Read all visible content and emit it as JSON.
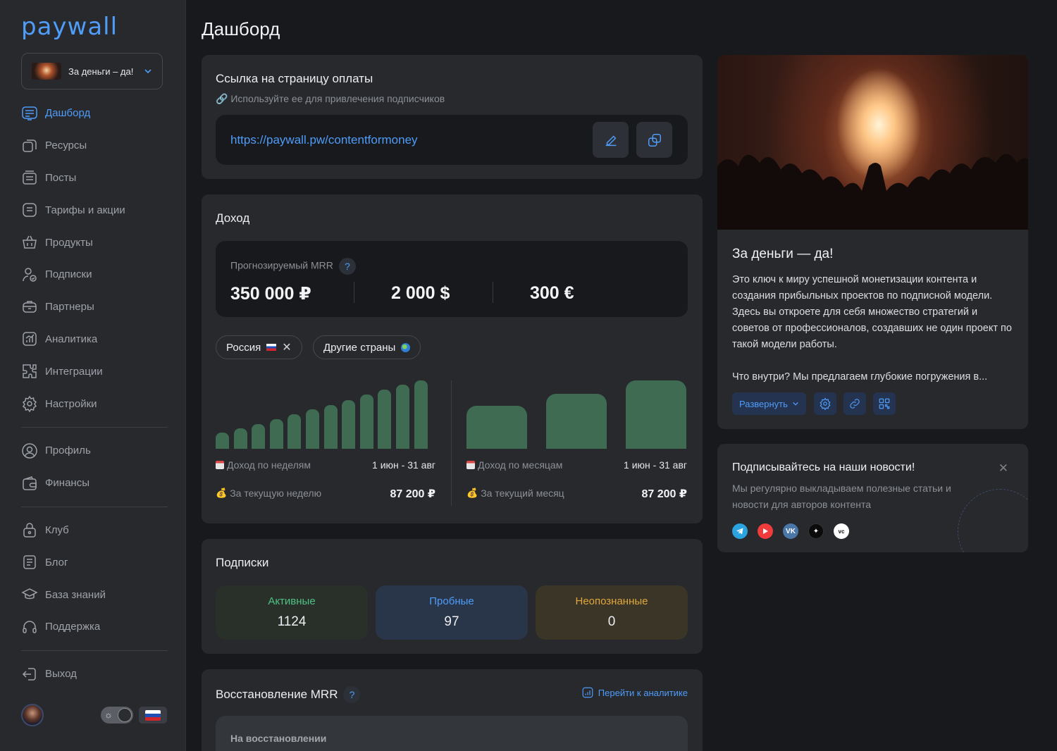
{
  "app": {
    "logo": "paywall"
  },
  "project_select": {
    "name": "За деньги – да!"
  },
  "nav": {
    "main": [
      "Дашборд",
      "Ресурсы",
      "Посты",
      "Тарифы и акции",
      "Продукты",
      "Подписки",
      "Партнеры",
      "Аналитика",
      "Интеграции",
      "Настройки"
    ],
    "account": [
      "Профиль",
      "Финансы"
    ],
    "resources": [
      "Клуб",
      "Блог",
      "База знаний",
      "Поддержка"
    ],
    "logout": "Выход"
  },
  "page": {
    "title": "Дашборд"
  },
  "payment_link": {
    "title": "Ссылка на страницу оплаты",
    "hint": "Используйте ее для привлечения подписчиков",
    "url": "https://paywall.pw/contentformoney"
  },
  "income": {
    "title": "Доход",
    "mrr_label": "Прогнозируемый MRR",
    "mrr_values": [
      "350 000 ₽",
      "2 000 $",
      "300 €"
    ],
    "chips": [
      "Россия",
      "Другие страны"
    ],
    "weekly": {
      "caption": "Доход по неделям",
      "period": "1 июн - 31 авг",
      "current_label": "За текущую неделю",
      "current_value": "87 200 ₽"
    },
    "monthly": {
      "caption": "Доход по месяцам",
      "period": "1 июн - 31 авг",
      "current_label": "За текущий месяц",
      "current_value": "87 200 ₽"
    }
  },
  "chart_data": [
    {
      "type": "bar",
      "title": "Доход по неделям",
      "values": [
        24,
        30,
        36,
        43,
        51,
        58,
        64,
        71,
        79,
        87,
        94,
        100
      ]
    },
    {
      "type": "bar",
      "title": "Доход по месяцам",
      "values": [
        63,
        80,
        100
      ]
    }
  ],
  "subscriptions": {
    "title": "Подписки",
    "stats": [
      {
        "label": "Активные",
        "value": "1124",
        "color": "#4fc285",
        "bg": "#283029"
      },
      {
        "label": "Пробные",
        "value": "97",
        "color": "#4f9cf9",
        "bg": "#293548"
      },
      {
        "label": "Неопознанные",
        "value": "0",
        "color": "#e1a73c",
        "bg": "#3a3527"
      }
    ]
  },
  "restore": {
    "title": "Восстановление MRR",
    "link": "Перейти к аналитике",
    "inner_label": "На восстановлении"
  },
  "project_card": {
    "name": "За деньги — да!",
    "desc_1": "Это ключ к миру успешной монетизации контента и создания прибыльных проектов по подписной модели. Здесь вы откроете для себя множество стратегий и советов от профессионалов, создавших не один проект по такой модели работы.",
    "desc_2": "Что внутри? Мы предлагаем глубокие погружения в...",
    "expand": "Развернуть"
  },
  "news": {
    "title": "Подписывайтесь на наши новости!",
    "text": "Мы регулярно выкладываем полезные статьи и новости для авторов контента",
    "socials": [
      "telegram-icon",
      "youtube-icon",
      "vk-icon",
      "dzen-icon",
      "vc-icon"
    ]
  },
  "colors": {
    "accent": "#4f9cf9",
    "bar": "#3e6b51",
    "card": "#27292d",
    "bg": "#18191c"
  }
}
